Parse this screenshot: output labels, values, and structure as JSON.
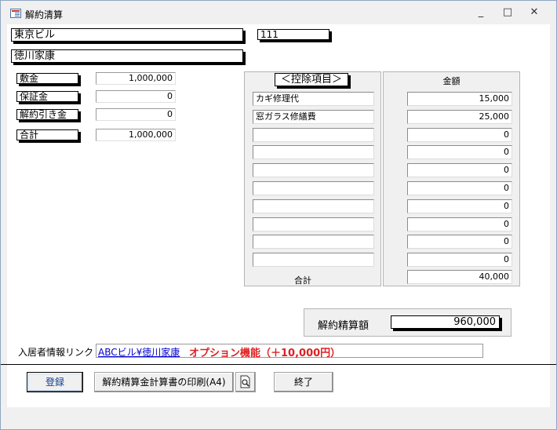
{
  "window": {
    "title": "解約清算",
    "minimize": "_",
    "maximize": "□",
    "close": "✕"
  },
  "header": {
    "building": "東京ビル",
    "room": "111",
    "tenant": "徳川家康"
  },
  "deposits": [
    {
      "label": "敷金",
      "value": "1,000,000"
    },
    {
      "label": "保証金",
      "value": "0"
    },
    {
      "label": "解約引き金",
      "value": "0"
    }
  ],
  "deposit_total": {
    "label": "合計",
    "value": "1,000,000"
  },
  "deductions": {
    "header_item": "＜控除項目＞",
    "header_amount": "金額",
    "rows": [
      {
        "item": "カギ修理代",
        "amount": "15,000"
      },
      {
        "item": "窓ガラス修繕費",
        "amount": "25,000"
      },
      {
        "item": "",
        "amount": "0"
      },
      {
        "item": "",
        "amount": "0"
      },
      {
        "item": "",
        "amount": "0"
      },
      {
        "item": "",
        "amount": "0"
      },
      {
        "item": "",
        "amount": "0"
      },
      {
        "item": "",
        "amount": "0"
      },
      {
        "item": "",
        "amount": "0"
      },
      {
        "item": "",
        "amount": "0"
      }
    ],
    "total_label": "合計",
    "total_amount": "40,000"
  },
  "settlement": {
    "label": "解約精算額",
    "value": "960,000"
  },
  "link": {
    "label": "入居者情報リンク",
    "value": "ABCビル¥徳川家康",
    "option_note": "オプション機能（＋10,000円）"
  },
  "buttons": {
    "register": "登録",
    "print": "解約精算金計算書の印刷(A4)",
    "end": "終了"
  },
  "colors": {
    "link": "#0000cc",
    "option": "#e02020",
    "accent": "#0c3c8c"
  }
}
